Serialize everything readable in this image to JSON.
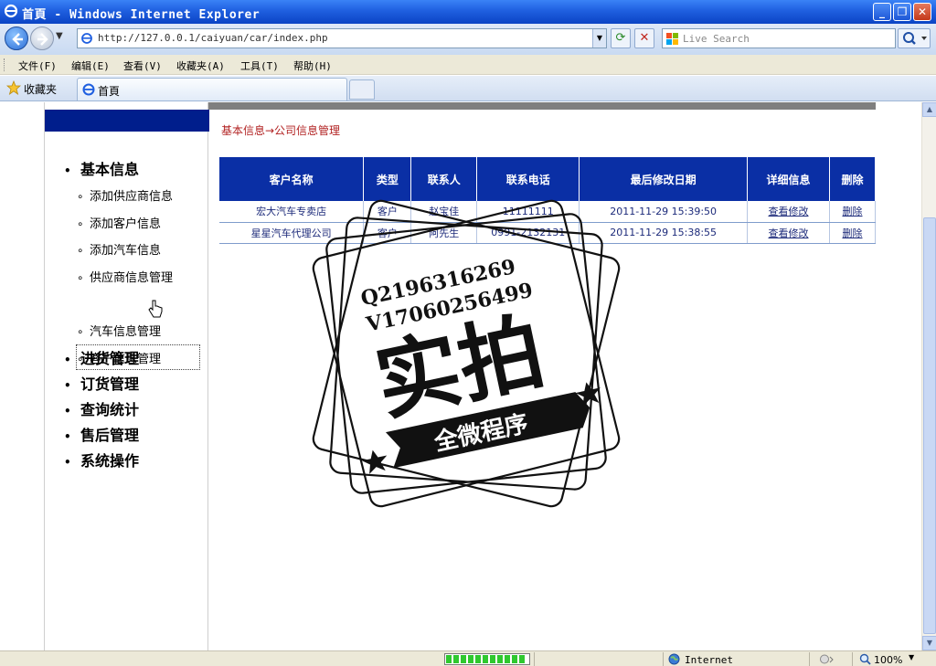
{
  "window": {
    "title": "首頁 - Windows Internet Explorer"
  },
  "address": {
    "url": "http://127.0.0.1/caiyuan/car/index.php"
  },
  "search": {
    "placeholder": "Live Search"
  },
  "menu": [
    "文件(F)",
    "编辑(E)",
    "查看(V)",
    "收藏夹(A)",
    "工具(T)",
    "帮助(H)"
  ],
  "favorites": {
    "label": "收藏夹"
  },
  "tab": {
    "title": "首頁"
  },
  "breadcrumb": "基本信息→公司信息管理",
  "nav": {
    "sections": [
      {
        "label": "基本信息",
        "items": [
          "添加供应商信息",
          "添加客户信息",
          "添加汽车信息",
          "供应商信息管理",
          "客户信息管理",
          "汽车信息管理"
        ]
      },
      {
        "label": "进货管理"
      },
      {
        "label": "订货管理"
      },
      {
        "label": "查询统计"
      },
      {
        "label": "售后管理"
      },
      {
        "label": "系统操作"
      }
    ]
  },
  "table": {
    "headers": [
      "客户名称",
      "类型",
      "联系人",
      "联系电话",
      "最后修改日期",
      "详细信息",
      "删除"
    ],
    "rows": [
      [
        "宏大汽车专卖店",
        "客户",
        "赵宝佳",
        "11111111",
        "2011-11-29 15:39:50",
        "查看修改",
        "删除"
      ],
      [
        "星星汽车代理公司",
        "客户",
        "阿先生",
        "0991-2132131",
        "2011-11-29 15:38:55",
        "查看修改",
        "删除"
      ]
    ]
  },
  "watermark": {
    "line1": "Q2196316269",
    "line2": "V17060256499",
    "main": "实拍",
    "banner": "全微程序"
  },
  "status": {
    "zone": "Internet",
    "zoom": "100%",
    "progress": 0.98
  },
  "colors": {
    "nav_bar": "#001e8c",
    "table_header": "#0a2fa5",
    "breadcrumb": "#b22222"
  }
}
